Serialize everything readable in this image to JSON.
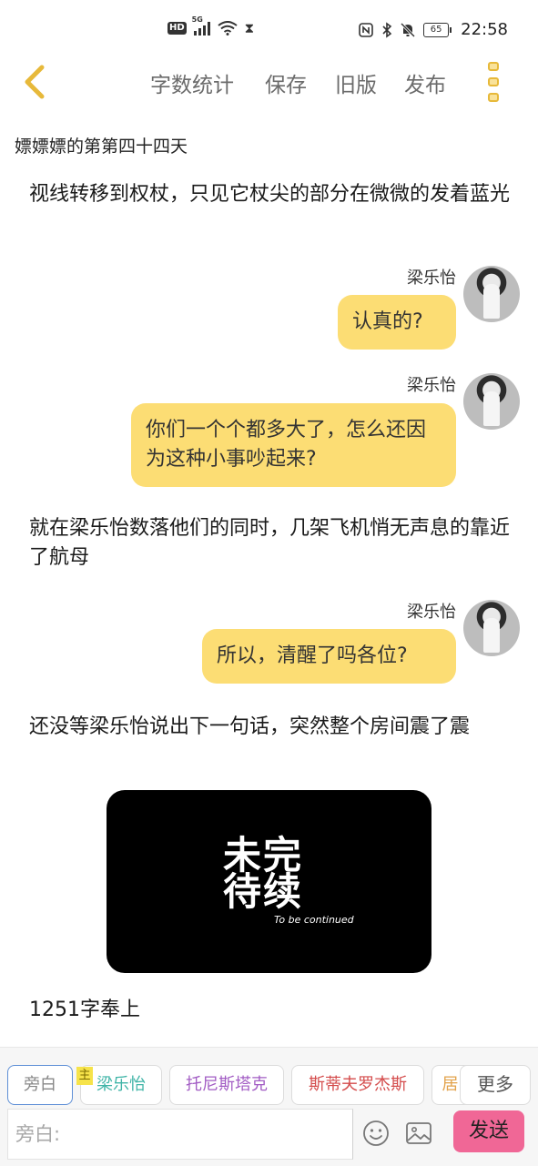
{
  "status_bar": {
    "hd": "HD",
    "network": "5G",
    "battery": "65",
    "time": "22:58",
    "icons": [
      "hd-icon",
      "signal-icon",
      "wifi-icon",
      "hourglass-icon",
      "nfc-icon",
      "bluetooth-icon",
      "mute-icon",
      "battery-icon"
    ]
  },
  "header": {
    "back_icon": "chevron-left-icon",
    "menu": [
      "字数统计",
      "保存",
      "旧版",
      "发布"
    ],
    "more_icon": "more-vertical-icon",
    "accent": "#e7b93a"
  },
  "chapter_title": "嫖嫖嫖的第第四十四天",
  "story": {
    "n1": "视线转移到权杖，只见它杖尖的部分在微微的发着蓝光",
    "d1_name": "梁乐怡",
    "d1_text": "认真的?",
    "d2_name": "梁乐怡",
    "d2_text": "你们一个个都多大了，怎么还因为这种小事吵起来?",
    "n2": "就在梁乐怡数落他们的同时，几架飞机悄无声息的靠近了航母",
    "d3_name": "梁乐怡",
    "d3_text": "所以，清醒了吗各位?",
    "n3": "还没等梁乐怡说出下一句话，突然整个房间震了震",
    "image_text_big": "未完待续",
    "image_text_small": "To be continued",
    "n4": "1251字奉上"
  },
  "characters": {
    "narrator": "旁白",
    "host_badge": "主",
    "c1": "梁乐怡",
    "c2": "托尼斯塔克",
    "c3": "斯蒂夫罗杰斯",
    "c4": "居",
    "more": "更多",
    "colors": {
      "c1": "#3fb4a7",
      "c2": "#a25cc4",
      "c3": "#d44c4c",
      "c4": "#e2a24a"
    }
  },
  "composer": {
    "placeholder": "旁白:",
    "emoji_icon": "emoji-icon",
    "image_icon": "image-icon",
    "send": "发送",
    "send_color": "#f06796"
  },
  "bubble_color": "#fcdd74"
}
